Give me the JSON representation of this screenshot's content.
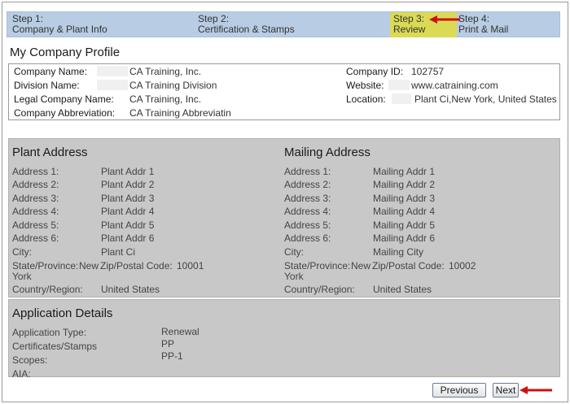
{
  "steps": [
    {
      "line1": "Step 1:",
      "line2": "Company & Plant Info"
    },
    {
      "line1": "Step 2:",
      "line2": "Certification & Stamps"
    },
    {
      "line1": "Step 3:",
      "line2": "Review"
    },
    {
      "line1": "Step 4:",
      "line2": "Print & Mail"
    }
  ],
  "profile": {
    "title": "My Company Profile",
    "company_name_label": "Company Name:",
    "company_name": "CA Training, Inc.",
    "division_name_label": "Division Name:",
    "division_name": "CA Training Division",
    "legal_name_label": "Legal Company Name:",
    "legal_name": "CA Training, Inc.",
    "abbrev_label": "Company Abbreviation:",
    "abbrev": "CA Training Abbreviatin",
    "company_id_label": "Company ID:",
    "company_id": "102757",
    "website_label": "Website:",
    "website": "www.catraining.com",
    "location_label": "Location:",
    "location": "Plant Ci,New York, United States"
  },
  "plant": {
    "title": "Plant Address",
    "rows": [
      {
        "label": "Address 1:",
        "value": "Plant Addr 1"
      },
      {
        "label": "Address 2:",
        "value": "Plant Addr 2"
      },
      {
        "label": "Address 3:",
        "value": "Plant Addr 3"
      },
      {
        "label": "Address 4:",
        "value": "Plant Addr 4"
      },
      {
        "label": "Address 5:",
        "value": "Plant Addr 5"
      },
      {
        "label": "Address 6:",
        "value": "Plant Addr 6"
      },
      {
        "label": "City:",
        "value": "Plant Ci"
      }
    ],
    "state_label": "State/Province:",
    "state_value_1": "New",
    "state_value_2": "York",
    "zip_label": "Zip/Postal Code:",
    "zip_value": "10001",
    "country_label": "Country/Region:",
    "country_value": "United States"
  },
  "mailing": {
    "title": "Mailing Address",
    "rows": [
      {
        "label": "Address 1:",
        "value": "Mailing Addr 1"
      },
      {
        "label": "Address 2:",
        "value": "Mailing Addr 2"
      },
      {
        "label": "Address 3:",
        "value": "Mailing Addr 3"
      },
      {
        "label": "Address 4:",
        "value": "Mailing Addr 4"
      },
      {
        "label": "Address 5:",
        "value": "Mailing Addr 5"
      },
      {
        "label": "Address 6:",
        "value": "Mailing Addr 6"
      },
      {
        "label": "City:",
        "value": "Mailing City"
      }
    ],
    "state_label": "State/Province:",
    "state_value_1": "New",
    "state_value_2": "York",
    "zip_label": "Zip/Postal Code:",
    "zip_value": "10002",
    "country_label": "Country/Region:",
    "country_value": "United States"
  },
  "application": {
    "title": "Application Details",
    "type_label": "Application Type:",
    "type_value": "Renewal",
    "certs_label": "Certificates/Stamps",
    "certs_value": "PP",
    "scopes_label": "Scopes:",
    "scopes_value": "PP-1",
    "aia_label": "AIA:"
  },
  "buttons": {
    "previous": "Previous",
    "next": "Next"
  },
  "colors": {
    "steps_bg": "#b8cce4",
    "active_step_bg": "#dada55",
    "panel_bg": "#c8c8c8",
    "arrow": "#cc1111"
  },
  "icons": {
    "step_pointer": "arrow-left-icon",
    "next_pointer": "arrow-left-icon"
  }
}
